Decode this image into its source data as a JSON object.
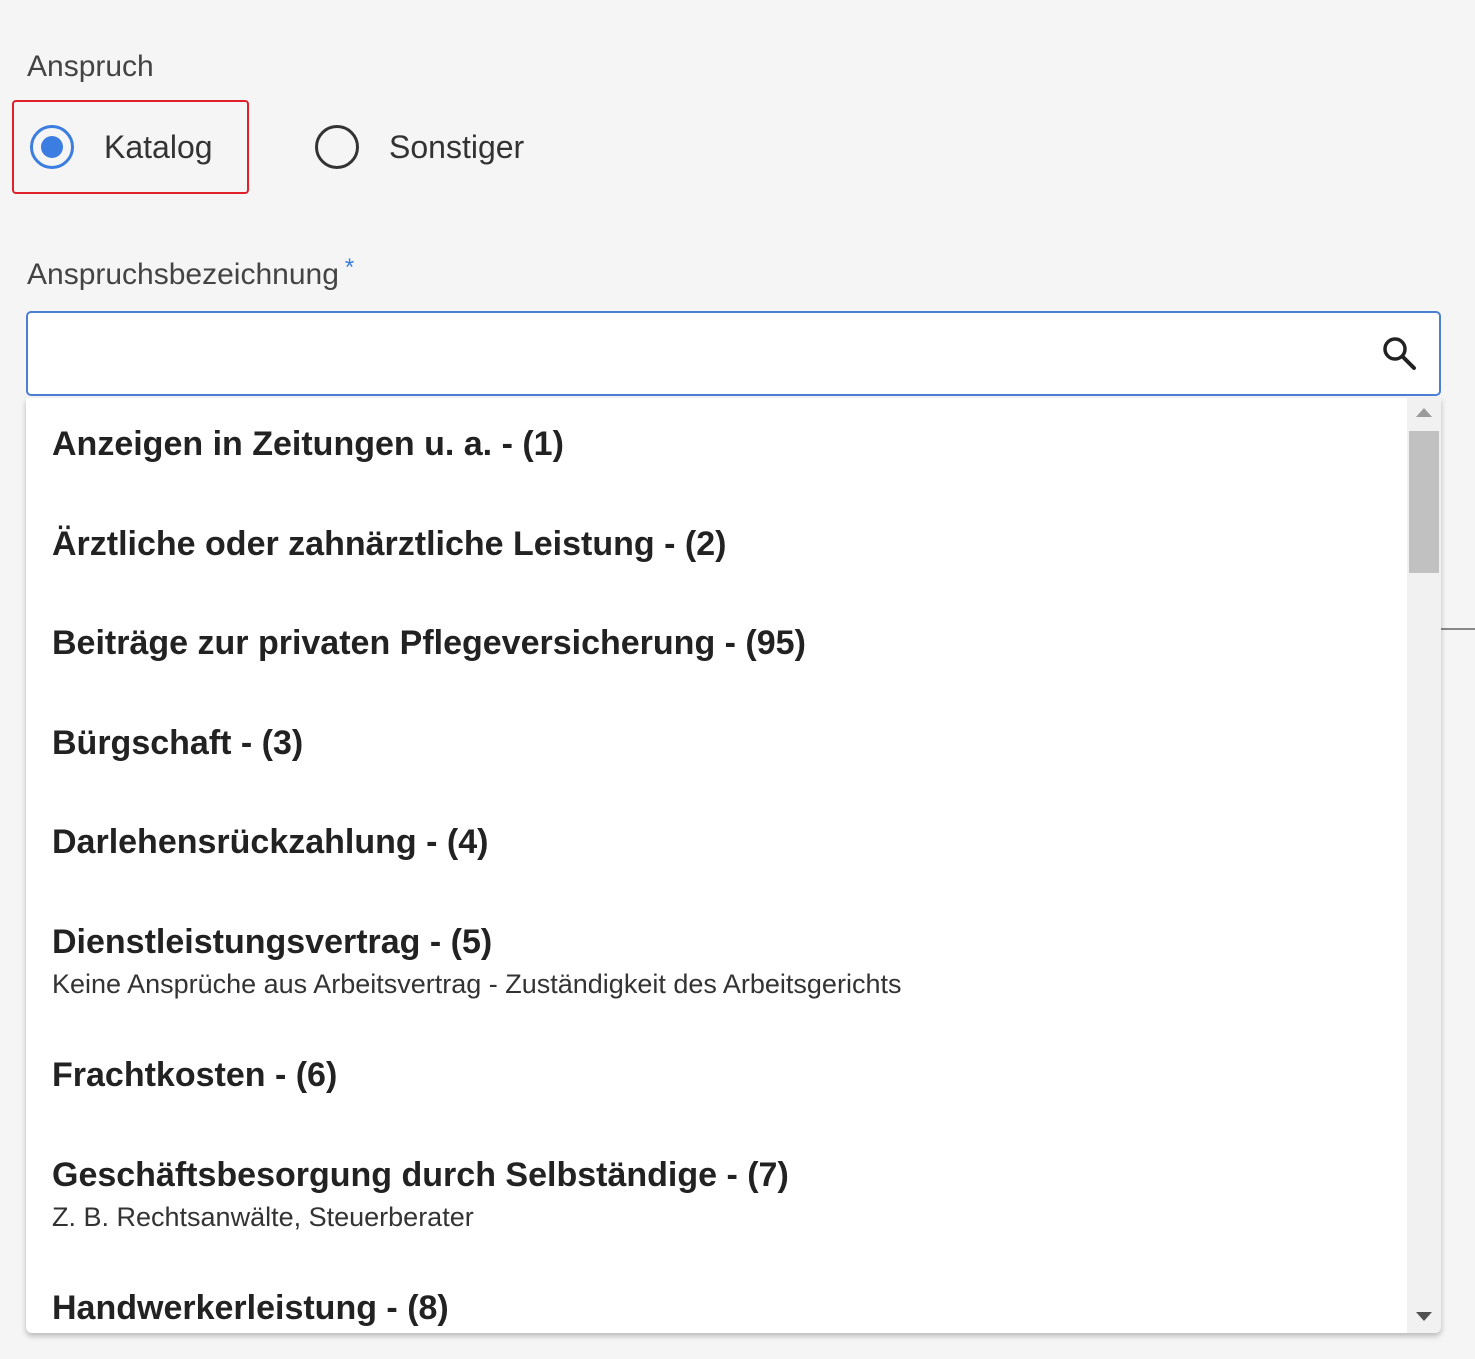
{
  "claim": {
    "label": "Anspruch",
    "options": [
      {
        "label": "Katalog",
        "checked": true
      },
      {
        "label": "Sonstiger",
        "checked": false
      }
    ]
  },
  "claim_name": {
    "label": "Anspruchsbezeichnung",
    "required_marker": "*",
    "value": "",
    "placeholder": ""
  },
  "catalog": {
    "items": [
      {
        "title": "Anzeigen in Zeitungen u. a. - (1)",
        "description": ""
      },
      {
        "title": "Ärztliche oder zahnärztliche Leistung - (2)",
        "description": ""
      },
      {
        "title": "Beiträge zur privaten Pflegeversicherung - (95)",
        "description": ""
      },
      {
        "title": "Bürgschaft - (3)",
        "description": ""
      },
      {
        "title": "Darlehensrückzahlung - (4)",
        "description": ""
      },
      {
        "title": "Dienstleistungsvertrag - (5)",
        "description": "Keine Ansprüche aus Arbeitsvertrag - Zuständigkeit des Arbeitsgerichts"
      },
      {
        "title": "Frachtkosten - (6)",
        "description": ""
      },
      {
        "title": "Geschäftsbesorgung durch Selbständige - (7)",
        "description": "Z. B. Rechtsanwälte, Steuerberater"
      },
      {
        "title": "Handwerkerleistung - (8)",
        "description": ""
      }
    ]
  },
  "icons": {
    "search": "search-icon",
    "scroll_up": "scroll-up-arrow-icon",
    "scroll_down": "scroll-down-arrow-icon"
  },
  "colors": {
    "accent": "#3b7de0",
    "focus_outline": "#e0202a",
    "input_border": "#4a7fd4"
  }
}
